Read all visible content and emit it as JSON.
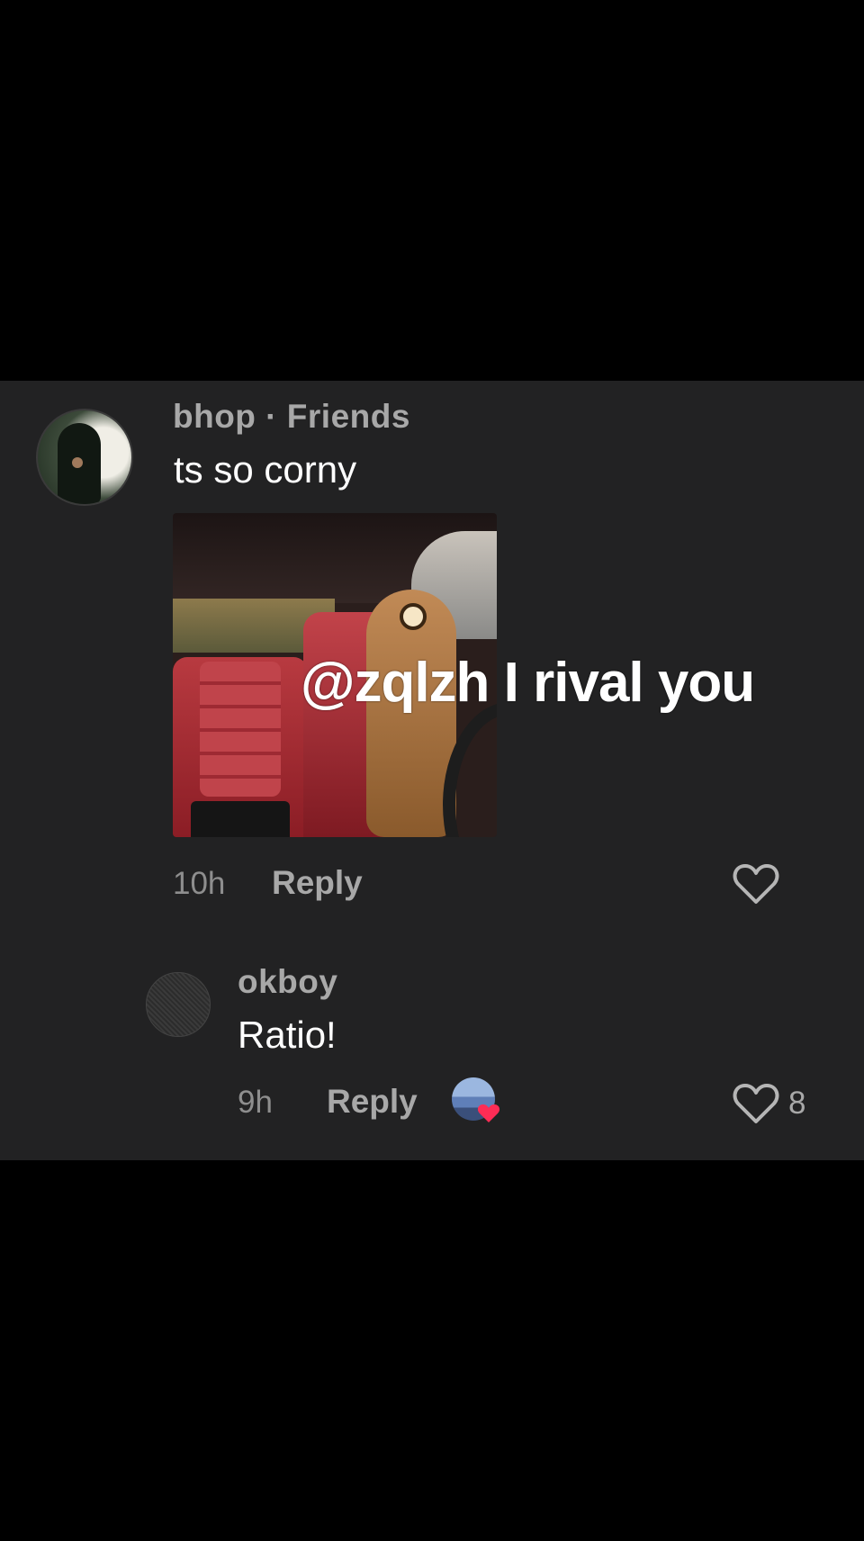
{
  "comment": {
    "username": "bhop · Friends",
    "text": "ts so corny",
    "gif_caption": "@zqlzh I rival you",
    "time": "10h",
    "reply_label": "Reply"
  },
  "reply": {
    "username": "okboy",
    "text": "Ratio!",
    "time": "9h",
    "reply_label": "Reply",
    "like_count": "8"
  },
  "colors": {
    "panel_bg": "#222223",
    "page_bg": "#000000",
    "heart_badge": "#fe2c55"
  }
}
